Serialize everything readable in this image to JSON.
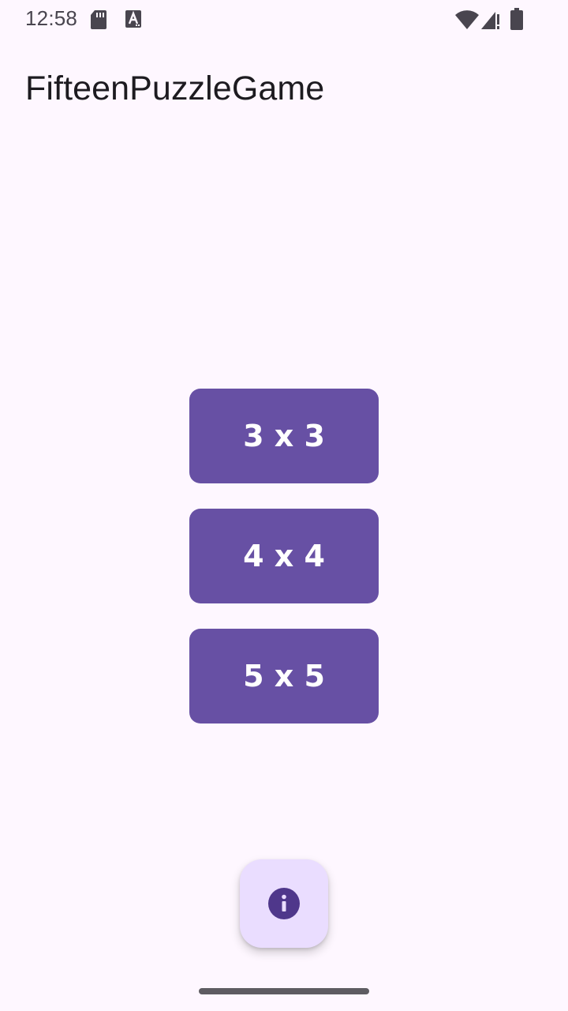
{
  "status_bar": {
    "time": "12:58",
    "icons": [
      "sd-card-icon",
      "text-a-icon",
      "wifi-icon",
      "signal-icon",
      "battery-icon"
    ]
  },
  "app_bar": {
    "title": "FifteenPuzzleGame"
  },
  "size_options": [
    {
      "label": "3 x 3"
    },
    {
      "label": "4 x 4"
    },
    {
      "label": "5 x 5"
    }
  ],
  "fab": {
    "icon": "info-icon"
  },
  "colors": {
    "background": "#FEF7FF",
    "primary": "#6750A4",
    "on_primary": "#FFFFFF",
    "fab_container": "#EADDFF",
    "fab_icon": "#4F378B"
  }
}
